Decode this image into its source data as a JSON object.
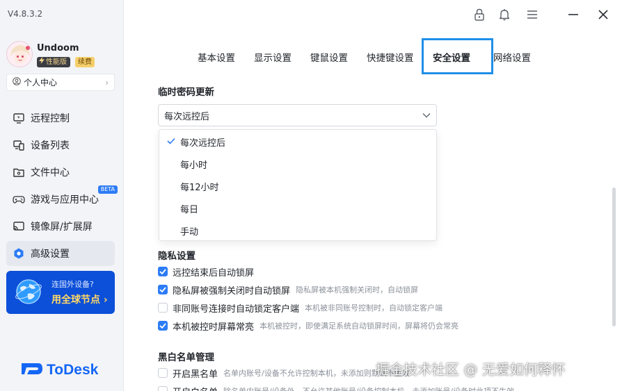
{
  "app": {
    "version": "V4.8.3.2",
    "logo_text": "ToDesk",
    "brand_color": "#1466f5",
    "accent_color": "#2d7cf6"
  },
  "user": {
    "name": "Undoom",
    "badge_perf": "性能版",
    "badge_renew": "续费",
    "personal_center": "个人中心"
  },
  "sidebar": {
    "items": [
      {
        "label": "远程控制",
        "icon": "remote-control-icon",
        "active": false
      },
      {
        "label": "设备列表",
        "icon": "device-list-icon",
        "active": false
      },
      {
        "label": "文件中心",
        "icon": "folder-icon",
        "active": false
      },
      {
        "label": "游戏与应用中心",
        "icon": "gamepad-icon",
        "active": false,
        "badge": "BETA"
      },
      {
        "label": "镜像屏/扩展屏",
        "icon": "cast-screen-icon",
        "active": false
      },
      {
        "label": "高级设置",
        "icon": "advanced-settings-icon",
        "active": true
      }
    ],
    "promo": {
      "line1": "连国外设备?",
      "line2": "用全球节点 ›"
    }
  },
  "titlebar": {
    "icons": [
      "lock-icon",
      "bell-icon",
      "menu-icon",
      "minimize-icon",
      "close-icon"
    ]
  },
  "tabs": [
    {
      "label": "基本设置",
      "active": false
    },
    {
      "label": "显示设置",
      "active": false
    },
    {
      "label": "键鼠设置",
      "active": false
    },
    {
      "label": "快捷键设置",
      "active": false
    },
    {
      "label": "安全设置",
      "active": true
    },
    {
      "label": "网络设置",
      "active": false
    }
  ],
  "temp_password": {
    "title": "临时密码更新",
    "selected": "每次远控后",
    "options": [
      "每次远控后",
      "每小时",
      "每12小时",
      "每日",
      "手动"
    ]
  },
  "privacy": {
    "title": "隐私设置",
    "items": [
      {
        "label": "远控结束后自动锁屏",
        "desc": "",
        "checked": true
      },
      {
        "label": "隐私屏被强制关闭时自动锁屏",
        "desc": "隐私屏被本机强制关闭时，自动锁屏",
        "checked": true
      },
      {
        "label": "非同账号连接时自动锁定客户端",
        "desc": "本机被非同账号控制时，自动锁定客户端",
        "checked": false
      },
      {
        "label": "本机被控时屏幕常亮",
        "desc": "本机被控时，即使满足系统自动锁屏时间，屏幕将仍会常亮",
        "checked": true
      }
    ]
  },
  "blackwhite": {
    "title": "黑白名单管理",
    "items": [
      {
        "label": "开启黑名单",
        "desc": "名单内账号/设备不允许控制本机，未添加则默认不生效",
        "checked": false
      },
      {
        "label": "开启白名单",
        "desc": "除名单内账号/设备外，不允许其他账号/设备控制本机，未添加账号/设备时此项不生效",
        "checked": false
      }
    ]
  },
  "watermark": "掘金技术社区 @ 无爱如何释怀"
}
